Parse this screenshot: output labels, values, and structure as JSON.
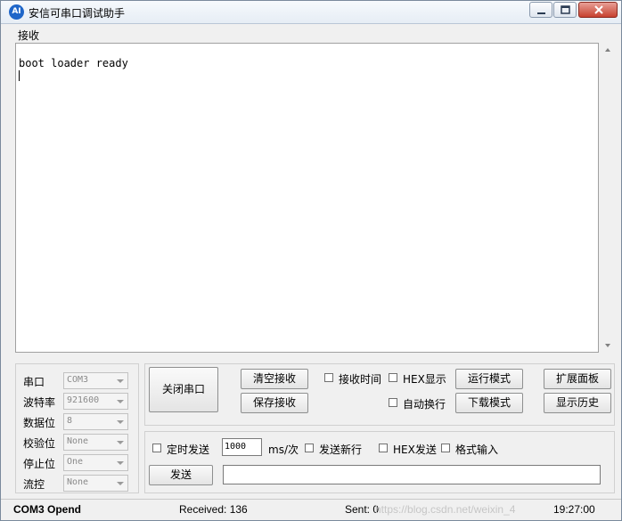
{
  "window": {
    "title": "安信可串口调试助手",
    "icon_text": "AI"
  },
  "receive": {
    "group_label": "接收",
    "content": "boot loader ready"
  },
  "settings": [
    {
      "label": "串口",
      "value": "COM3"
    },
    {
      "label": "波特率",
      "value": "921600"
    },
    {
      "label": "数据位",
      "value": "8"
    },
    {
      "label": "校验位",
      "value": "None"
    },
    {
      "label": "停止位",
      "value": "One"
    },
    {
      "label": "流控",
      "value": "None"
    }
  ],
  "controls": {
    "close_port": "关闭串口",
    "clear_receive": "清空接收",
    "save_receive": "保存接收",
    "recv_time": "接收时间",
    "hex_display": "HEX显示",
    "auto_newline": "自动换行",
    "run_mode": "运行模式",
    "download_mode": "下载模式",
    "expand_panel": "扩展面板",
    "show_history": "显示历史"
  },
  "send": {
    "timed_send": "定时发送",
    "interval_value": "1000",
    "interval_unit": "ms/次",
    "send_newline": "发送新行",
    "hex_send": "HEX发送",
    "format_input": "格式输入",
    "send_button": "发送",
    "send_text": ""
  },
  "status": {
    "port_state": "COM3 Opend",
    "received": "Received: 136",
    "sent": "Sent: 0",
    "watermark": "https://blog.csdn.net/weixin_4",
    "time": "19:27:00"
  },
  "icons": {
    "app": "ai-thinker-logo-icon",
    "minimize": "minimize-icon",
    "maximize": "maximize-icon",
    "close": "close-icon"
  }
}
